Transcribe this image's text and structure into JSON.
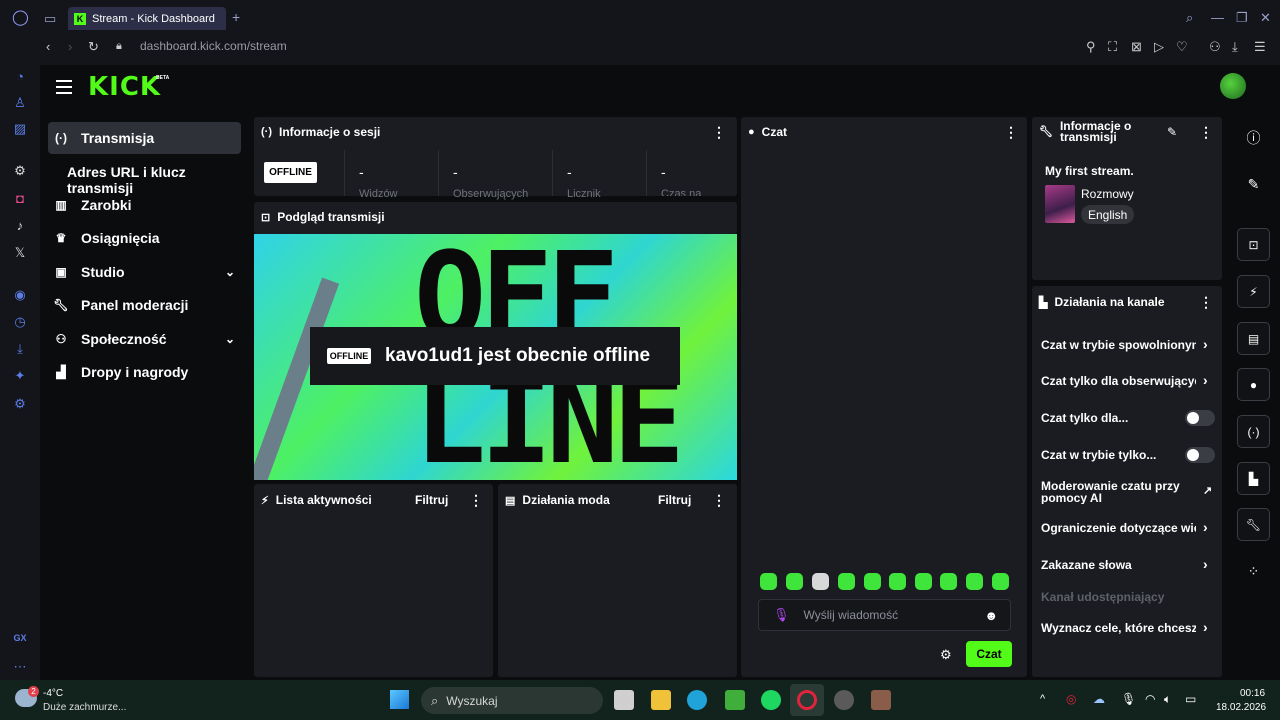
{
  "browser": {
    "tab_title": "Stream - Kick Dashboard",
    "new_tab": "+",
    "url": "dashboard.kick.com/stream"
  },
  "header": {
    "logo": "KICK",
    "beta": "BETA"
  },
  "nav": {
    "items": [
      {
        "label": "Transmisja",
        "icon": "broadcast-icon"
      },
      {
        "label": "Adres URL i klucz transmisji"
      },
      {
        "label": "Zarobki",
        "icon": "chart-icon"
      },
      {
        "label": "Osiągnięcia",
        "icon": "trophy-icon"
      },
      {
        "label": "Studio",
        "icon": "studio-icon"
      },
      {
        "label": "Panel moderacji",
        "icon": "wrench-icon"
      },
      {
        "label": "Społeczność",
        "icon": "community-icon"
      },
      {
        "label": "Dropy i nagrody",
        "icon": "drops-icon"
      }
    ]
  },
  "session": {
    "title": "Informacje o sesji",
    "status": "OFFLINE",
    "stats": [
      {
        "value": "-",
        "label": "Widzów"
      },
      {
        "value": "-",
        "label": "Obserwujących"
      },
      {
        "value": "-",
        "label": "Licznik"
      },
      {
        "value": "-",
        "label": "Czas na"
      }
    ]
  },
  "preview": {
    "title": "Podgląd transmisji",
    "art_top": "OFF",
    "art_bottom": "LINE",
    "badge": "OFFLINE",
    "message": "kavo1ud1 jest obecnie offline"
  },
  "activity": {
    "title": "Lista aktywności",
    "filter": "Filtruj"
  },
  "modactions": {
    "title": "Działania moda",
    "filter": "Filtruj"
  },
  "chat": {
    "title": "Czat",
    "placeholder": "Wyślij wiadomość",
    "send": "Czat"
  },
  "stream_info": {
    "title": "Informacje o transmisji",
    "stream_title": "My first stream.",
    "category": "Rozmowy",
    "language": "English"
  },
  "channel_actions": {
    "title": "Działania na kanale",
    "items": [
      {
        "label": "Czat w trybie spowolnionym",
        "control": "chevron"
      },
      {
        "label": "Czat tylko dla obserwujących",
        "control": "chevron"
      },
      {
        "label": "Czat tylko dla...",
        "control": "toggle"
      },
      {
        "label": "Czat w trybie tylko...",
        "control": "toggle"
      },
      {
        "label": "Moderowanie czatu przy pomocy AI",
        "control": "external"
      },
      {
        "label": "Ograniczenie dotyczące wieku",
        "control": "chevron"
      },
      {
        "label": "Zakazane słowa",
        "control": "chevron"
      },
      {
        "label": "Kanał udostępniający",
        "control": "none"
      },
      {
        "label": "Wyznacz cele, które chcesz osiągnąć",
        "control": "chevron"
      }
    ]
  },
  "taskbar": {
    "temp": "-4°C",
    "weather": "Duże zachmurze...",
    "weather_badge": "2",
    "search": "Wyszukaj",
    "time": "00:16",
    "date": "18.02.2026"
  },
  "colors": {
    "accent": "#53fc18",
    "panel": "#1a1c21"
  }
}
